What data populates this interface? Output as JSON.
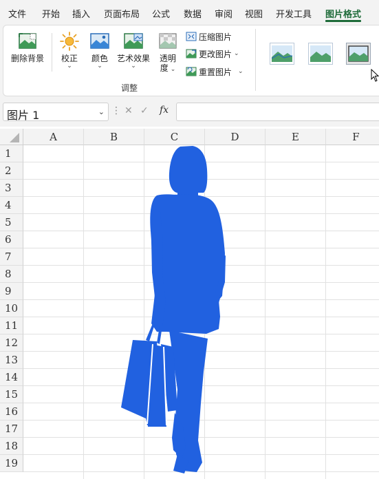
{
  "ribbon_tabs": [
    {
      "label": "文件"
    },
    {
      "label": "开始"
    },
    {
      "label": "插入"
    },
    {
      "label": "页面布局"
    },
    {
      "label": "公式"
    },
    {
      "label": "数据"
    },
    {
      "label": "审阅"
    },
    {
      "label": "视图"
    },
    {
      "label": "开发工具"
    },
    {
      "label": "图片格式",
      "active": true
    }
  ],
  "ribbon": {
    "remove_background": "删除背景",
    "corrections": "校正",
    "color": "颜色",
    "artistic_effects": "艺术效果",
    "transparency_line1": "透明",
    "transparency_line2": "度",
    "compress_pictures": "压缩图片",
    "change_picture": "更改图片",
    "reset_picture": "重置图片",
    "adjust_group": "调整",
    "chevron": "⌄"
  },
  "formula_bar": {
    "name_box": "图片 1",
    "name_box_caret": "⌄",
    "separator": "⋮",
    "cancel": "✕",
    "enter": "✓",
    "fx": "fx",
    "formula": ""
  },
  "columns": [
    "A",
    "B",
    "C",
    "D",
    "E",
    "F"
  ],
  "rows": [
    "1",
    "2",
    "3",
    "4",
    "5",
    "6",
    "7",
    "8",
    "9",
    "10",
    "11",
    "12",
    "13",
    "14",
    "15",
    "16",
    "17",
    "18",
    "19"
  ],
  "colors": {
    "accent": "#1e6b39",
    "silhouette": "#2161e0",
    "ribbon_bg": "#f3f3f3",
    "gridline": "#e1e1e1"
  }
}
